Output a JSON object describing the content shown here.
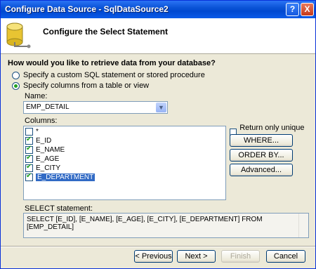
{
  "window": {
    "title": "Configure Data Source - SqlDataSource2",
    "help_glyph": "?",
    "close_glyph": "X"
  },
  "header": {
    "icon": "database-icon",
    "title": "Configure the Select Statement"
  },
  "form": {
    "question": "How would you like to retrieve data from your database?",
    "option_custom": "Specify a custom SQL statement or stored procedure",
    "option_columns": "Specify columns from a table or view",
    "selected_option": "option_columns",
    "name_label": "Name:",
    "name_value": "EMP_DETAIL",
    "columns_label": "Columns:",
    "columns": [
      {
        "name": "*",
        "checked": false,
        "selected": false
      },
      {
        "name": "E_ID",
        "checked": true,
        "selected": false
      },
      {
        "name": "E_NAME",
        "checked": true,
        "selected": false
      },
      {
        "name": "E_AGE",
        "checked": true,
        "selected": false
      },
      {
        "name": "E_CITY",
        "checked": true,
        "selected": false
      },
      {
        "name": "E_DEPARTMENT",
        "checked": true,
        "selected": true
      }
    ],
    "unique_rows_label": "Return only unique rows",
    "where_label": "WHERE...",
    "orderby_label": "ORDER BY...",
    "advanced_label": "Advanced...",
    "statement_label": "SELECT statement:",
    "statement_text": "SELECT [E_ID], [E_NAME], [E_AGE], [E_CITY], [E_DEPARTMENT] FROM [EMP_DETAIL]"
  },
  "footer": {
    "previous_label": "< Previous",
    "next_label": "Next >",
    "finish_label": "Finish",
    "cancel_label": "Cancel"
  },
  "colors": {
    "titlebar": "#0a53d6",
    "selection": "#316ac5",
    "dialog_bg": "#ece9d8"
  }
}
